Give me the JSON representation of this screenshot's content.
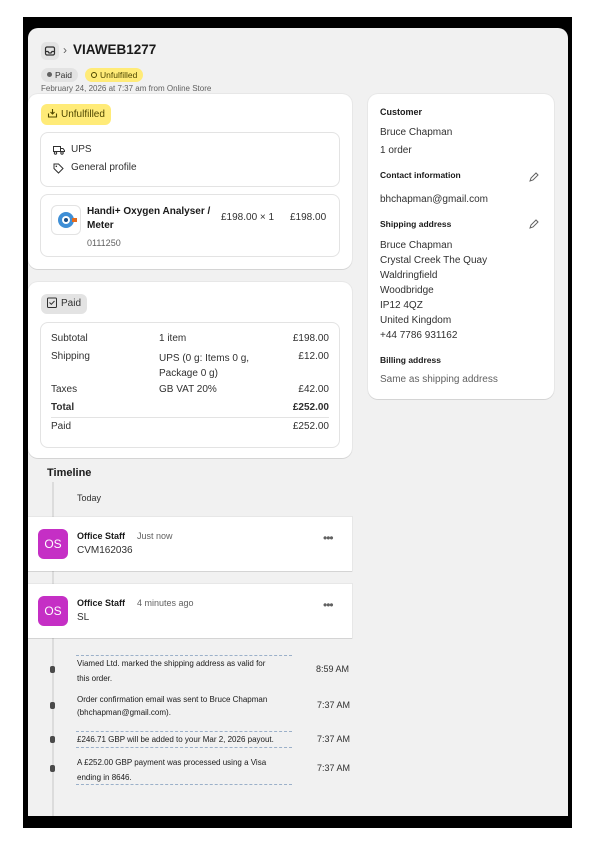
{
  "header": {
    "order_id": "VIAWEB1277",
    "paid_badge": "Paid",
    "fulfillment_badge": "Unfulfilled",
    "meta": "February 24, 2026 at 7:37 am from Online Store"
  },
  "fulfillment_card": {
    "status_badge": "Unfulfilled",
    "carrier": "UPS",
    "profile": "General profile",
    "item": {
      "name_line1": "Handi+ Oxygen Analyser /",
      "name_line2": "Meter",
      "sku": "0111250",
      "price_qty": "£198.00 × 1",
      "total": "£198.00"
    }
  },
  "payment_card": {
    "status_badge": "Paid",
    "rows": {
      "subtotal": {
        "label": "Subtotal",
        "detail": "1 item",
        "amount": "£198.00"
      },
      "shipping": {
        "label": "Shipping",
        "detail_line1": "UPS (0 g: Items 0 g,",
        "detail_line2": "Package 0 g)",
        "amount": "£12.00"
      },
      "taxes": {
        "label": "Taxes",
        "detail": "GB VAT 20%",
        "amount": "£42.00"
      },
      "total": {
        "label": "Total",
        "amount": "£252.00"
      },
      "paid": {
        "label": "Paid",
        "amount": "£252.00"
      }
    }
  },
  "timeline": {
    "heading": "Timeline",
    "day_label": "Today",
    "comments": [
      {
        "initials": "OS",
        "author": "Office Staff",
        "time": "Just now",
        "text": "CVM162036"
      },
      {
        "initials": "OS",
        "author": "Office Staff",
        "time": "4 minutes ago",
        "text": "SL"
      }
    ],
    "events": [
      {
        "line1": "Viamed Ltd. marked the shipping address as valid for",
        "line2": "this order.",
        "time": "8:59 AM"
      },
      {
        "line1": "Order confirmation email was sent to Bruce Chapman",
        "line2": "(bhchapman@gmail.com).",
        "time": "7:37 AM"
      },
      {
        "line1": "£246.71 GBP will be added to your Mar 2, 2026 payout.",
        "line2": "",
        "time": "7:37 AM"
      },
      {
        "line1": "A £252.00 GBP payment was processed using a Visa",
        "line2": "ending in 8646.",
        "time": "7:37 AM"
      }
    ]
  },
  "customer_card": {
    "heading": "Customer",
    "name": "Bruce Chapman",
    "orders": "1 order",
    "contact_heading": "Contact information",
    "email": "bhchapman@gmail.com",
    "shipping_heading": "Shipping address",
    "shipping_lines": [
      "Bruce Chapman",
      "Crystal Creek The Quay",
      "Waldringfield",
      "Woodbridge",
      "IP12 4QZ",
      "United Kingdom",
      "+44 7786 931162"
    ],
    "billing_heading": "Billing address",
    "billing_text": "Same as shipping address"
  },
  "colors": {
    "unfulfilled_bg": "#ffeb78",
    "paid_bg": "#e3e3e3",
    "avatar": "#c52fc5",
    "event_underline": "#9bb0c9"
  },
  "icons": [
    "inbox-icon",
    "truck-icon",
    "tag-icon",
    "fulfillment-icon",
    "paid-icon",
    "edit-icon",
    "more-icon"
  ]
}
